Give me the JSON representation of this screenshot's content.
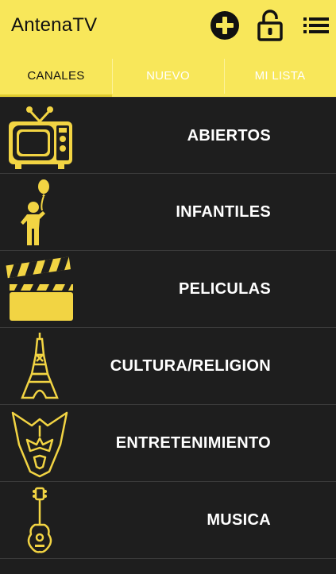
{
  "app": {
    "title": "AntenaTV",
    "accent_color": "#f8e75a",
    "background_color": "#1e1e1e"
  },
  "toolbar": {
    "actions": [
      {
        "icon": "add-circle-icon"
      },
      {
        "icon": "unlock-icon"
      },
      {
        "icon": "list-menu-icon"
      }
    ]
  },
  "tabs": [
    {
      "label": "CANALES",
      "active": true
    },
    {
      "label": "NUEVO",
      "active": false
    },
    {
      "label": "MI LISTA",
      "active": false
    }
  ],
  "categories": [
    {
      "label": "ABIERTOS",
      "icon": "tv-icon"
    },
    {
      "label": "INFANTILES",
      "icon": "child-balloon-icon"
    },
    {
      "label": "PELICULAS",
      "icon": "clapperboard-icon"
    },
    {
      "label": "CULTURA/RELIGION",
      "icon": "eiffel-tower-icon"
    },
    {
      "label": "ENTRETENIMIENTO",
      "icon": "decepticon-icon"
    },
    {
      "label": "MUSICA",
      "icon": "guitar-icon"
    }
  ]
}
